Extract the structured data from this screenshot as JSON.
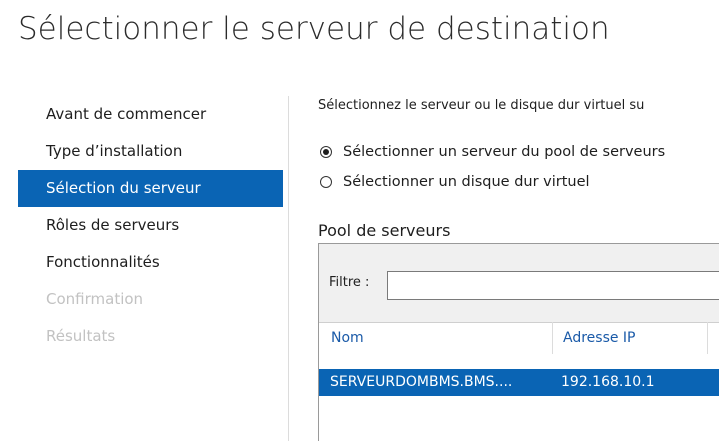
{
  "page": {
    "title": "Sélectionner le serveur de destination"
  },
  "nav": {
    "items": [
      {
        "label": "Avant de commencer"
      },
      {
        "label": "Type d’installation"
      },
      {
        "label": "Sélection du serveur"
      },
      {
        "label": "Rôles de serveurs"
      },
      {
        "label": "Fonctionnalités"
      },
      {
        "label": "Confirmation"
      },
      {
        "label": "Résultats"
      }
    ],
    "active_label": "Sélection du serveur",
    "disabled_labels": [
      "Confirmation",
      "Résultats"
    ]
  },
  "main": {
    "intro": "Sélectionnez le serveur ou le disque dur virtuel su",
    "radios": [
      {
        "label": "Sélectionner un serveur du pool de serveurs",
        "checked": true
      },
      {
        "label": "Sélectionner un disque dur virtuel",
        "checked": false
      }
    ],
    "pool": {
      "title": "Pool de serveurs",
      "filter_label": "Filtre :",
      "filter_value": "",
      "columns": [
        "Nom",
        "Adresse IP"
      ],
      "rows": [
        {
          "name": "SERVEURDOMBMS.BMS....",
          "ip": "192.168.10.1",
          "selected": true
        }
      ]
    }
  },
  "colors": {
    "accent": "#0a64b4",
    "column_header": "#1a5aa8",
    "disabled_text": "#c2c2c2"
  }
}
